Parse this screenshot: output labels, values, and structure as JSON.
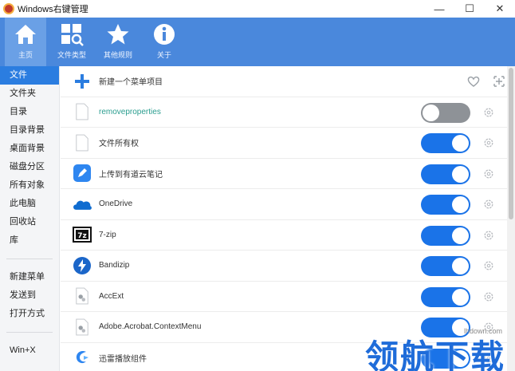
{
  "window": {
    "title": "Windows右键管理",
    "buttons": [
      "—",
      "☐",
      "✕"
    ]
  },
  "toolbar": {
    "items": [
      {
        "label": "主页",
        "icon": "home-icon",
        "active": true
      },
      {
        "label": "文件类型",
        "icon": "file-type-icon",
        "active": false
      },
      {
        "label": "其他规则",
        "icon": "star-icon",
        "active": false
      },
      {
        "label": "关于",
        "icon": "info-icon",
        "active": false
      }
    ]
  },
  "sidebar": {
    "group1": [
      "文件",
      "文件夹",
      "目录",
      "目录背景",
      "桌面背景",
      "磁盘分区",
      "所有对象",
      "此电脑",
      "回收站",
      "库"
    ],
    "group2": [
      "新建菜单",
      "发送到",
      "打开方式"
    ],
    "group3": [
      "Win+X"
    ],
    "active": "文件"
  },
  "main": {
    "new_item_label": "新建一个菜单项目",
    "rows": [
      {
        "name": "removeproperties",
        "enabled": false,
        "icon": "blank-file-icon"
      },
      {
        "name": "文件所有权",
        "enabled": true,
        "icon": "blank-file-icon"
      },
      {
        "name": "上传到有道云笔记",
        "enabled": true,
        "icon": "youdao-note-icon"
      },
      {
        "name": "OneDrive",
        "enabled": true,
        "icon": "onedrive-icon"
      },
      {
        "name": "7-zip",
        "enabled": true,
        "icon": "7zip-icon"
      },
      {
        "name": "Bandizip",
        "enabled": true,
        "icon": "bandizip-icon"
      },
      {
        "name": "AccExt",
        "enabled": true,
        "icon": "gear-file-icon"
      },
      {
        "name": "Adobe.Acrobat.ContextMenu",
        "enabled": true,
        "icon": "gear-file-icon"
      },
      {
        "name": "迅雷播放组件",
        "enabled": true,
        "icon": "xunlei-icon"
      }
    ]
  },
  "watermark": {
    "text": "领航下载",
    "url": "lhdown.com"
  },
  "colors": {
    "toolbar": "#4a88dc",
    "accent": "#1a73e8",
    "sidebar_active": "#2b7de0",
    "toggle_off": "#8e9297"
  }
}
